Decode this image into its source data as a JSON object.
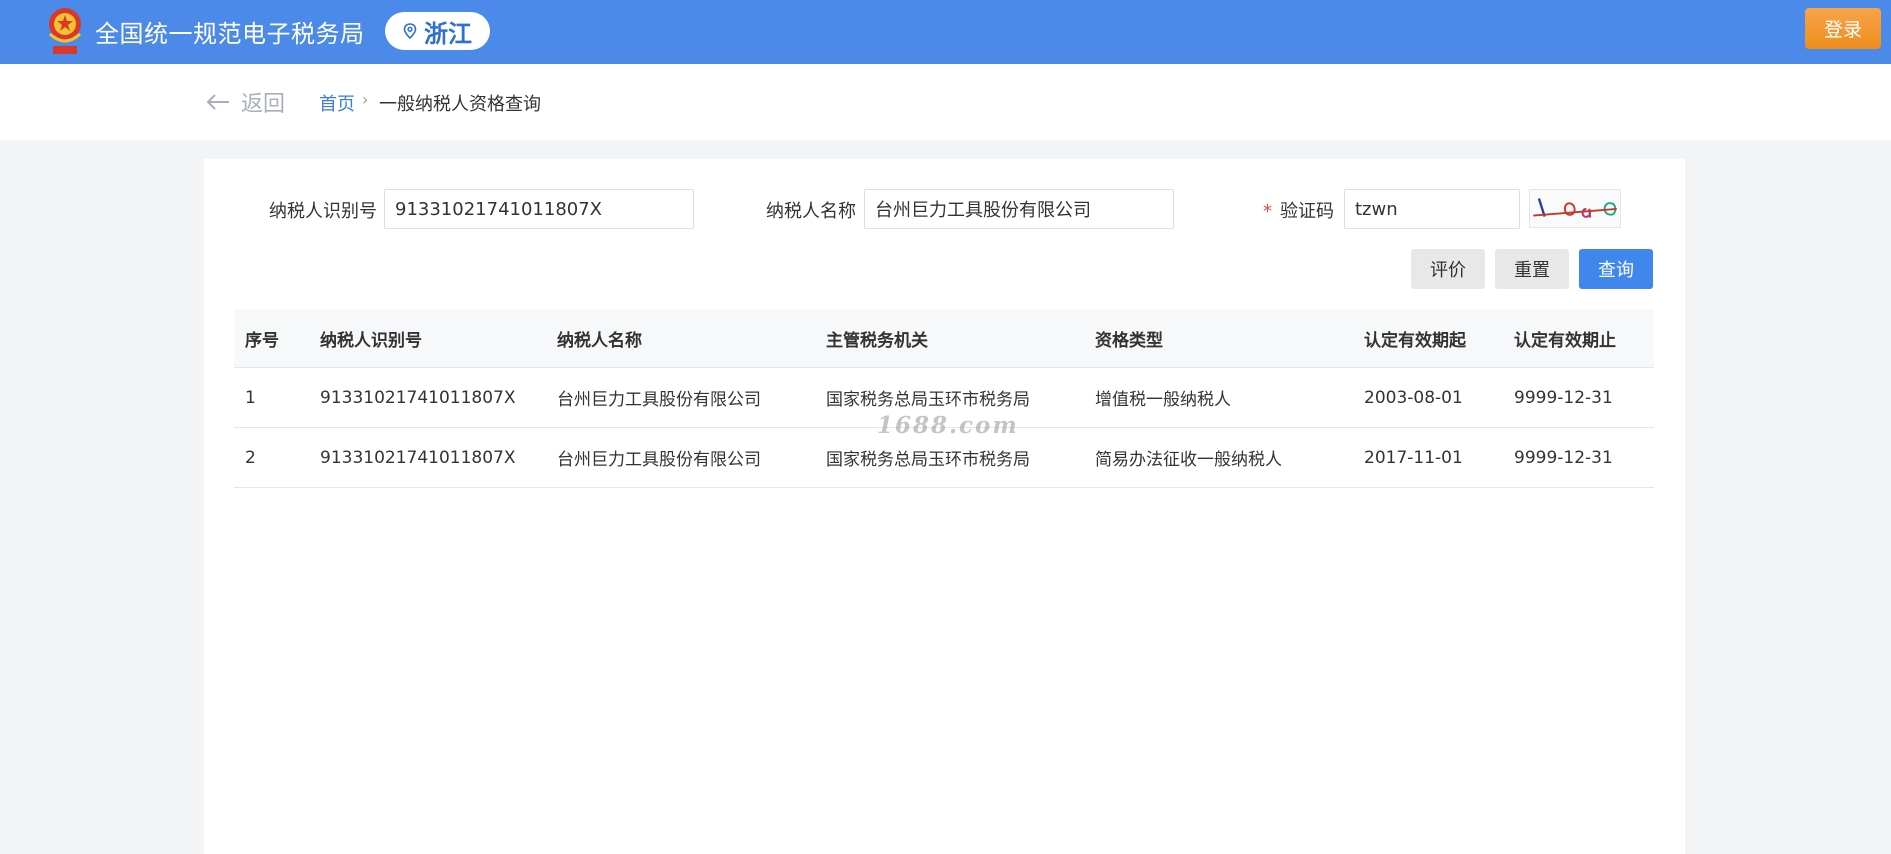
{
  "header": {
    "site_title": "全国统一规范电子税务局",
    "region": "浙江",
    "login_label": "登录",
    "brand_color": "#4b8ae9",
    "login_color": "#ef8d1d"
  },
  "breadcrumb": {
    "back_label": "返回",
    "home": "首页",
    "separator": "›",
    "current": "一般纳税人资格查询"
  },
  "form": {
    "taxpayer_id_label": "纳税人识别号",
    "taxpayer_id_value": "91331021741011807X",
    "taxpayer_name_label": "纳税人名称",
    "taxpayer_name_value": "台州巨力工具股份有限公司",
    "captcha_label": "验证码",
    "captcha_required_mark": "*",
    "captcha_value": "tzwn",
    "buttons": {
      "evaluate": "评价",
      "reset": "重置",
      "query": "查询"
    }
  },
  "table": {
    "columns": [
      "序号",
      "纳税人识别号",
      "纳税人名称",
      "主管税务机关",
      "资格类型",
      "认定有效期起",
      "认定有效期止"
    ],
    "rows": [
      [
        "1",
        "91331021741011807X",
        "台州巨力工具股份有限公司",
        "国家税务总局玉环市税务局",
        "增值税一般纳税人",
        "2003-08-01",
        "9999-12-31"
      ],
      [
        "2",
        "91331021741011807X",
        "台州巨力工具股份有限公司",
        "国家税务总局玉环市税务局",
        "简易办法征收一般纳税人",
        "2017-11-01",
        "9999-12-31"
      ]
    ]
  },
  "watermark": "1688.com"
}
